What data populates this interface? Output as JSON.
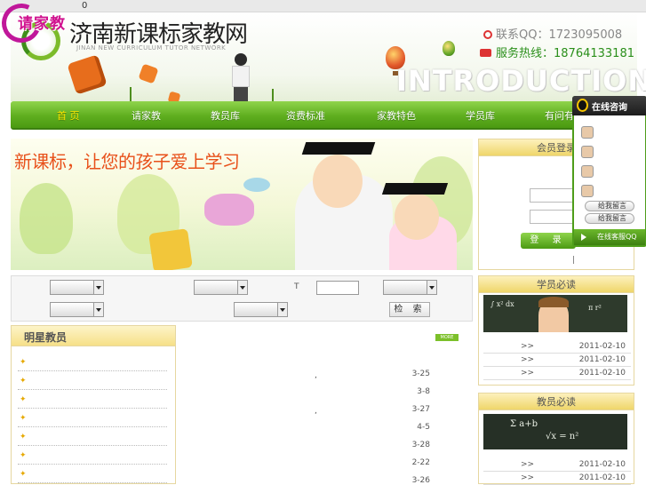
{
  "topbar": {
    "text": "0"
  },
  "badge": {
    "label": "请家教"
  },
  "header": {
    "title": "济南新课标家教网",
    "subtitle": "JINAN NEW CURRICULUM TUTOR NETWORK",
    "qq": "联系QQ：1723095008",
    "hotline": "服务热线：18764133181",
    "intro": "INTRODUCTION"
  },
  "nav": {
    "items": [
      {
        "label": "首  页",
        "active": true
      },
      {
        "label": "请家教"
      },
      {
        "label": "教员库"
      },
      {
        "label": "资费标准"
      },
      {
        "label": "家教特色"
      },
      {
        "label": "学员库"
      },
      {
        "label": "有问有"
      }
    ]
  },
  "banner": {
    "slogan": "新课标，让您的孩子爱上学习"
  },
  "search": {
    "t_label": "T",
    "button": "检 索"
  },
  "star_teachers": {
    "title": "明星教员",
    "rows": 7
  },
  "news": {
    "more": "MORE",
    "dates": [
      "3-25",
      "3-8",
      "3-27",
      "4-5",
      "3-28",
      "2-22",
      "3-26"
    ],
    "marks": [
      ",",
      ","
    ]
  },
  "member_login": {
    "title": "会员登录",
    "button": "登 录",
    "sep": "|"
  },
  "student_reading": {
    "title": "学员必读",
    "rows": [
      {
        "arrow": ">>",
        "date": "2011-02-10"
      },
      {
        "arrow": ">>",
        "date": "2011-02-10"
      },
      {
        "arrow": ">>",
        "date": "2011-02-10"
      }
    ]
  },
  "teacher_reading": {
    "title": "教员必读",
    "rows": [
      {
        "arrow": ">>",
        "date": "2011-02-10"
      },
      {
        "arrow": ">>",
        "date": "2011-02-10"
      }
    ]
  },
  "chat": {
    "title": "在线咨询",
    "msg1": "给我留言",
    "msg2": "给我留言",
    "footer": "在线客服QQ"
  },
  "colors": {
    "nav_green": "#5fae1f",
    "slogan": "#e8501a",
    "hotline": "#2a8f1a",
    "badge": "#d0128f"
  }
}
